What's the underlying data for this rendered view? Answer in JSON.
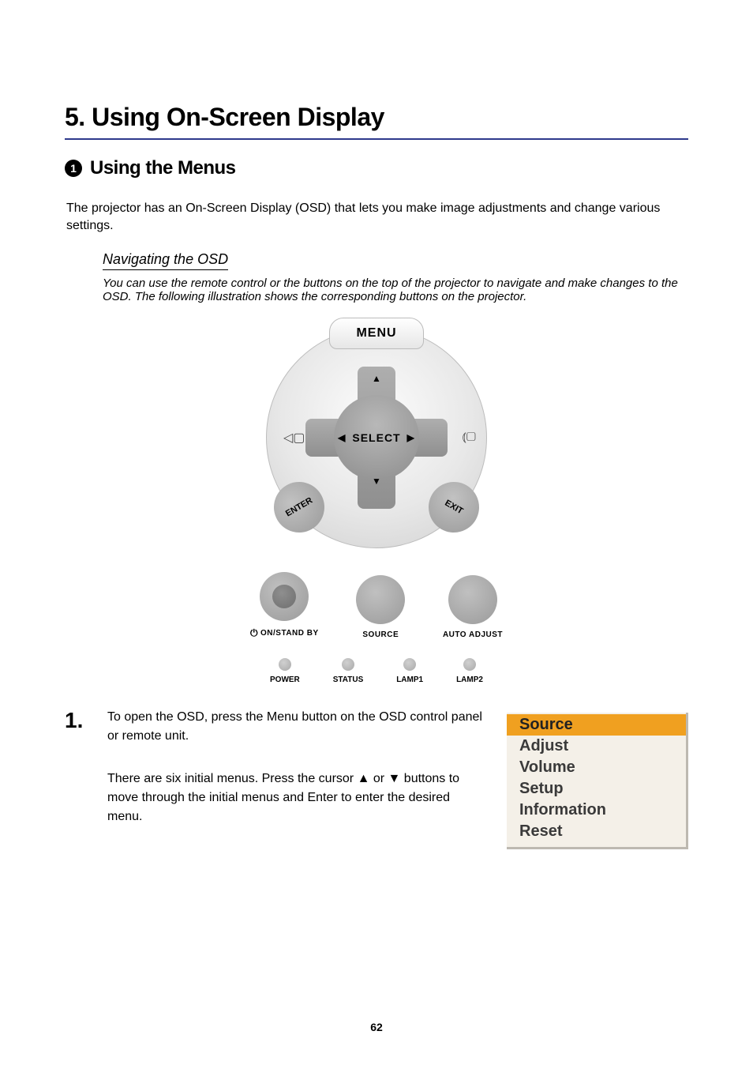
{
  "chapter_title": "5. Using On-Screen Display",
  "section": {
    "num_label": "1",
    "title": "Using the Menus"
  },
  "intro": "The projector has an On-Screen Display (OSD) that lets you make image adjustments and change various settings.",
  "subsection": {
    "title": "Navigating the OSD",
    "note": "You can use the remote control or the buttons on the top of the projector to navigate and make changes to the OSD. The following illustration shows the corresponding buttons on the projector."
  },
  "control_labels": {
    "menu": "MENU",
    "select": "SELECT",
    "enter": "ENTER",
    "exit": "EXIT"
  },
  "big_buttons": [
    {
      "label": "ON/STAND BY",
      "has_power_icon": true
    },
    {
      "label": "SOURCE",
      "has_power_icon": false
    },
    {
      "label": "AUTO ADJUST",
      "has_power_icon": false
    }
  ],
  "leds": [
    "POWER",
    "STATUS",
    "LAMP1",
    "LAMP2"
  ],
  "step": {
    "num": "1.",
    "line1": "To open the OSD, press the Menu button on the OSD control panel or remote unit.",
    "line2": "There are six initial menus. Press the cursor ▲ or ▼ buttons to move through the initial menus and Enter to enter the desired menu."
  },
  "osd_menu_items": [
    "Source",
    "Adjust",
    "Volume",
    "Setup",
    "Information",
    "Reset"
  ],
  "osd_selected_index": 0,
  "page_number": "62"
}
